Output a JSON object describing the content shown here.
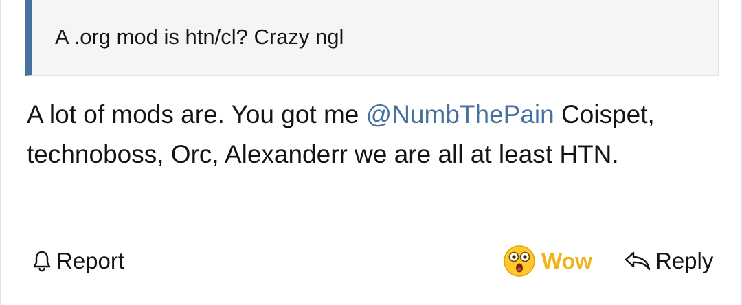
{
  "quote": {
    "text": "A .org mod is htn/cl? Crazy ngl"
  },
  "message": {
    "part1": "A lot of mods are. You got me ",
    "mention": "@NumbThePain",
    "part2": " Coispet, technoboss, Orc, Alexanderr we are all at least HTN."
  },
  "actions": {
    "report_label": "Report",
    "reaction_label": "Wow",
    "reply_label": "Reply",
    "report_icon": "bell-icon",
    "reaction_icon": "wow-emoji-icon",
    "reply_icon": "reply-arrow-icon"
  },
  "colors": {
    "accent": "#47729f",
    "reaction": "#f0b419",
    "text": "#141414",
    "quote_bg": "#f5f5f5"
  }
}
